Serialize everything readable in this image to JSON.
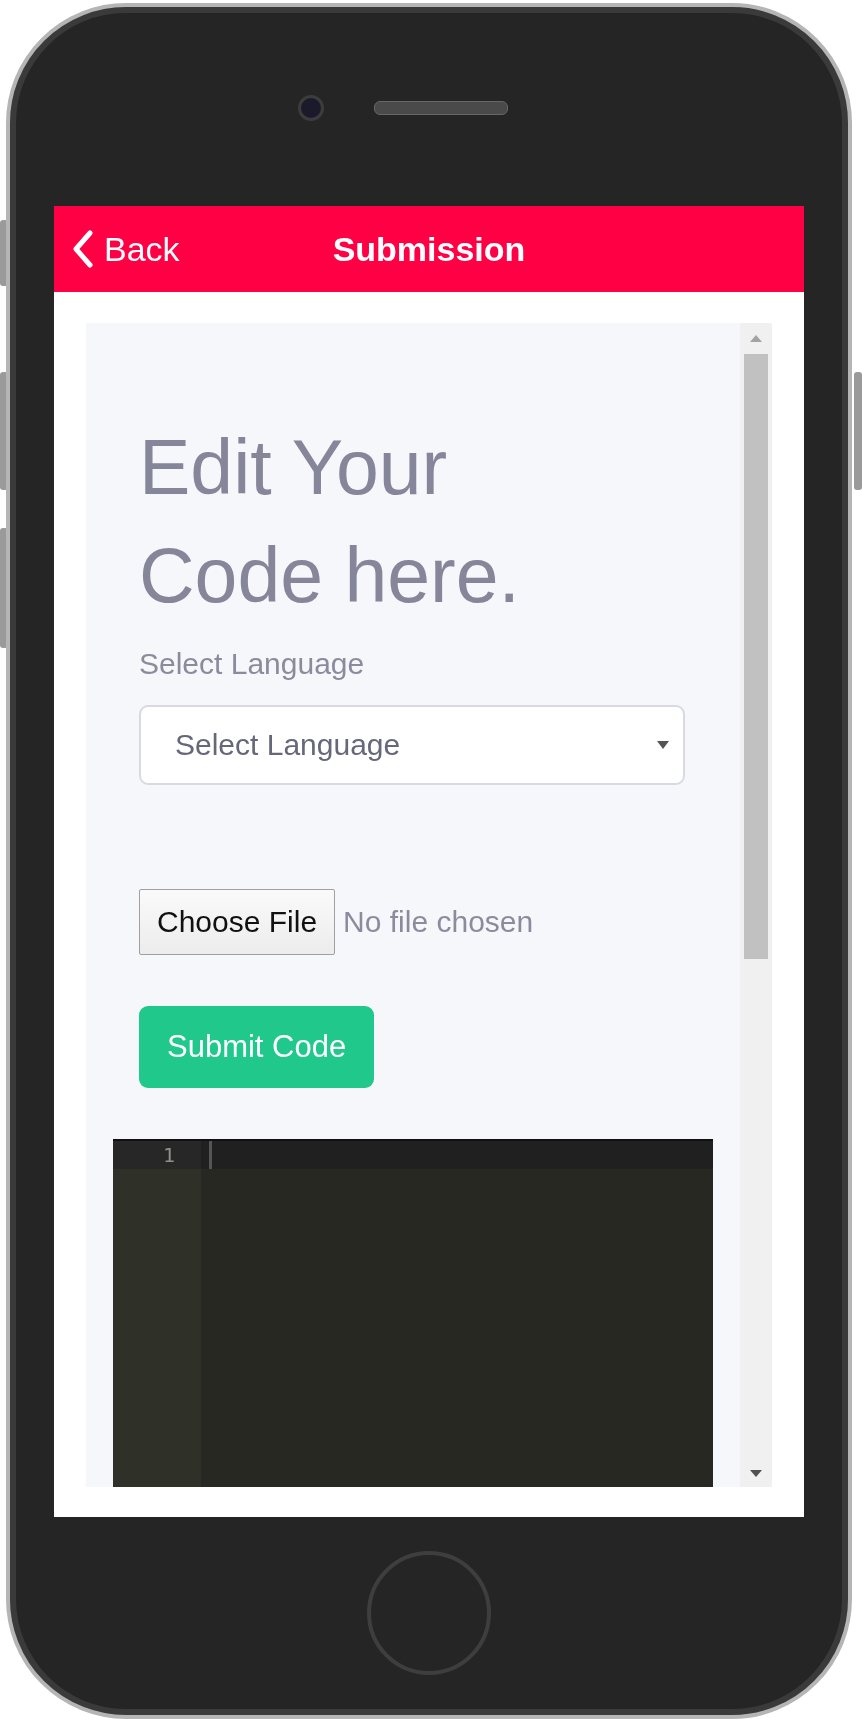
{
  "header": {
    "back_label": "Back",
    "title": "Submission"
  },
  "form": {
    "heading": "Edit Your Code here.",
    "language_label": "Select Language",
    "language_select": {
      "value": "Select Language"
    },
    "file_input": {
      "button_label": "Choose File",
      "status": "No file chosen"
    },
    "submit_button": "Submit Code"
  },
  "editor": {
    "line_numbers": [
      "1"
    ]
  }
}
